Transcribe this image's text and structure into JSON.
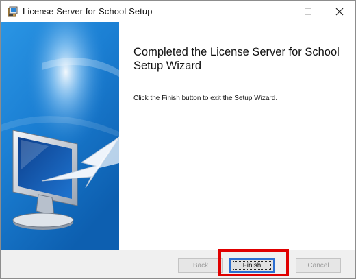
{
  "window": {
    "title": "License Server for School Setup",
    "icons": {
      "app": "setup-installer-icon",
      "minimize": "minimize-icon",
      "maximize": "maximize-icon",
      "close": "close-icon"
    }
  },
  "sidepanel": {
    "image": "monitor-arrow-illustration"
  },
  "content": {
    "heading": "Completed the License Server for School Setup Wizard",
    "message": "Click the Finish button to exit the Setup Wizard."
  },
  "buttons": {
    "back": "Back",
    "finish": "Finish",
    "cancel": "Cancel"
  },
  "colors": {
    "highlight": "#e00000",
    "panel_blue": "#1b7fd3",
    "focus_border": "#2c6fd1"
  }
}
